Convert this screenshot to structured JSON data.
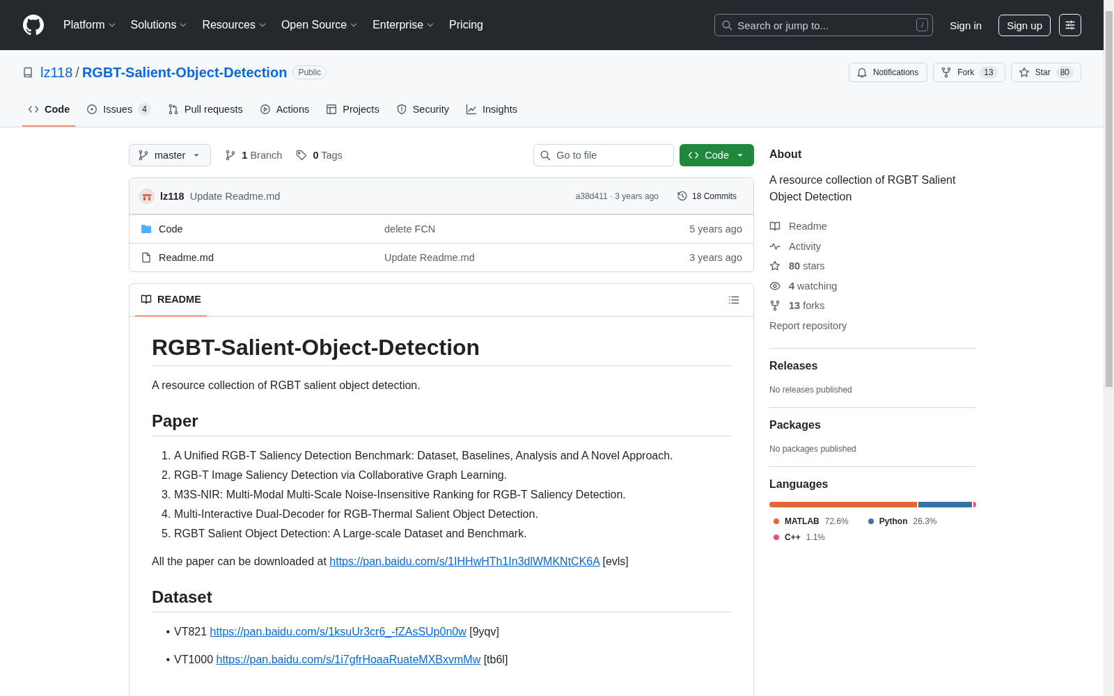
{
  "header": {
    "nav": [
      {
        "label": "Platform",
        "dropdown": true
      },
      {
        "label": "Solutions",
        "dropdown": true
      },
      {
        "label": "Resources",
        "dropdown": true
      },
      {
        "label": "Open Source",
        "dropdown": true
      },
      {
        "label": "Enterprise",
        "dropdown": true
      },
      {
        "label": "Pricing",
        "dropdown": false
      }
    ],
    "search": {
      "placeholder": "Search or jump to...",
      "shortcut": "/"
    },
    "sign_in": "Sign in",
    "sign_up": "Sign up"
  },
  "repo": {
    "owner": "lz118",
    "separator": "/",
    "name": "RGBT-Salient-Object-Detection",
    "visibility": "Public",
    "actions": [
      {
        "label": "Notifications"
      },
      {
        "label": "Fork",
        "count": "13"
      },
      {
        "label": "Star",
        "count": "80"
      }
    ]
  },
  "tabs": [
    {
      "label": "Code",
      "selected": true
    },
    {
      "label": "Issues",
      "count": "4",
      "selected": false
    },
    {
      "label": "Pull requests",
      "selected": false
    },
    {
      "label": "Actions",
      "selected": false
    },
    {
      "label": "Projects",
      "selected": false
    },
    {
      "label": "Security",
      "selected": false
    },
    {
      "label": "Insights",
      "selected": false
    }
  ],
  "toolbar": {
    "branch": "master",
    "branches": "**1** Branch",
    "tags": "**0** Tags",
    "go_to_file": {
      "placeholder": "Go to file"
    },
    "code_button": "Code"
  },
  "latest_commit": {
    "author": "lz118",
    "message": "Update Readme.md",
    "hash_age": "a38d411 · 3 years ago",
    "commits": "18 Commits"
  },
  "files": [
    {
      "kind": "folder",
      "name": "Code",
      "message": "delete FCN",
      "age": "5 years ago"
    },
    {
      "kind": "file",
      "name": "Readme.md",
      "message": "Update Readme.md",
      "age": "3 years ago"
    }
  ],
  "readme": {
    "tab": "README",
    "title": "RGBT-Salient-Object-Detection",
    "intro": "A resource collection of RGBT salient object detection.",
    "paper": {
      "heading": "Paper",
      "items": [
        {
          "marker": "1.",
          "text": "A Unified RGB-T Saliency Detection Benchmark: Dataset, Baselines, Analysis and A Novel Approach."
        },
        {
          "marker": "2.",
          "text": "RGB-T Image Saliency Detection via Collaborative Graph Learning."
        },
        {
          "marker": "3.",
          "text": "M3S-NIR: Multi-Modal Multi-Scale Noise-Insensitive Ranking for RGB-T Saliency Detection."
        },
        {
          "marker": "4.",
          "text": "Multi-Interactive Dual-Decoder for RGB-Thermal Salient Object Detection."
        },
        {
          "marker": "5.",
          "text": "RGBT Salient Object Detection: A Large-scale Dataset and Benchmark."
        }
      ],
      "download": {
        "text": "All the paper can be downloaded at",
        "link": "https://pan.baidu.com/s/1IHHwHTh1In3dlWMKNtCK6A",
        "suffix": "[evls]"
      }
    },
    "dataset": {
      "heading": "Dataset",
      "items": [
        {
          "marker": "•",
          "label": "VT821",
          "link": "https://pan.baidu.com/s/1ksuUr3cr6_-fZAsSUp0n0w",
          "suffix": "[9yqv]"
        },
        {
          "marker": "•",
          "label": "VT1000",
          "link": "https://pan.baidu.com/s/1i7gfrHoaaRuateMXBxvmMw",
          "suffix": "[tb6l]"
        }
      ]
    }
  },
  "sidebar": {
    "about": {
      "heading": "About",
      "description": "A resource collection of RGBT Salient Object Detection",
      "links": [
        "Readme",
        "Activity",
        "**80** stars",
        "**4** watching",
        "**13** forks"
      ],
      "report": "Report repository"
    },
    "releases": {
      "heading": "Releases",
      "note": "No releases published"
    },
    "packages": {
      "heading": "Packages",
      "note": "No packages published"
    },
    "languages": {
      "heading": "Languages",
      "items": [
        {
          "name": "MATLAB",
          "percent": "72.6%",
          "color": "#e16737",
          "level": 0.726
        },
        {
          "name": "Python",
          "percent": "26.3%",
          "color": "#3572a5",
          "level": 0.263
        },
        {
          "name": "C++",
          "percent": "1.1%",
          "color": "#f34b7d",
          "level": 0.011
        }
      ]
    }
  }
}
